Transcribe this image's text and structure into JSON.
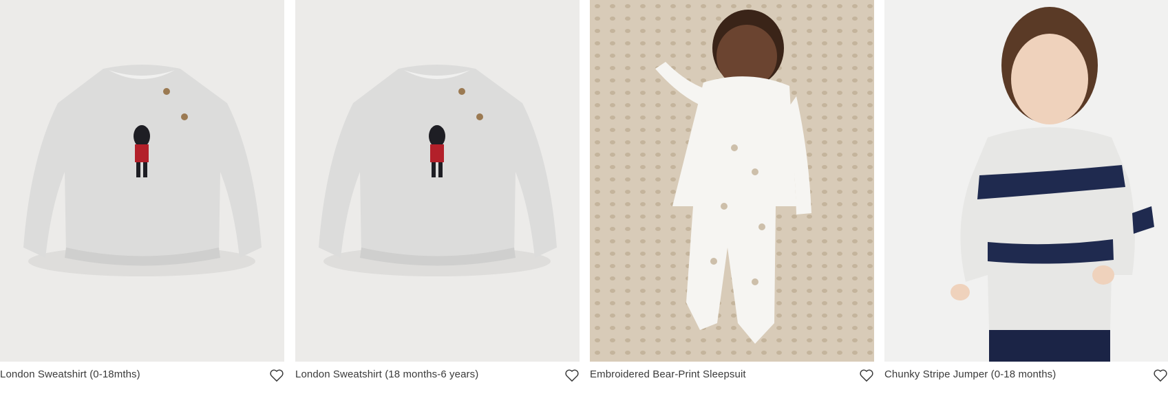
{
  "products": [
    {
      "title": "London Sweatshirt (0-18mths)",
      "wishlist_icon": "heart-outline-icon"
    },
    {
      "title": "London Sweatshirt (18 months-6 years)",
      "wishlist_icon": "heart-outline-icon"
    },
    {
      "title": "Embroidered Bear-Print Sleepsuit",
      "wishlist_icon": "heart-outline-icon"
    },
    {
      "title": "Chunky Stripe Jumper (0-18 months)",
      "wishlist_icon": "heart-outline-icon"
    }
  ],
  "colors": {
    "text": "#3a3a3a",
    "image_bg": "#ededeb",
    "sweatshirt": "#dcdcdb",
    "navy": "#1f2a4f",
    "guard_red": "#b3202a"
  }
}
